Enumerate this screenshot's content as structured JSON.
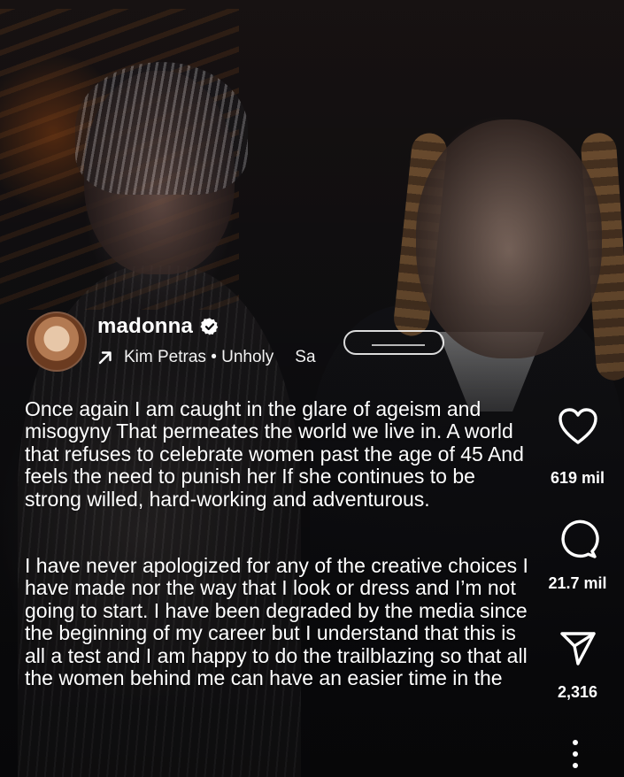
{
  "post": {
    "username": "madonna",
    "audio": "Kim Petras • Unholy",
    "audio_overflow": "Sa",
    "caption_para1": "Once again I am caught in the glare of ageism and misogyny  That permeates  the world we live in. A world that refuses to celebrate women past the age of 45 And feels the need to punish her If she continues to be strong willed,  hard-working  and adventurous.",
    "caption_para2": "I have never apologized for any of the creative choices I have made nor the way that I look or dress and I’m not going to start. I have been degraded by the media since the beginning of my career but I understand that this is all a test and I am happy to do the trailblazing  so that all the women behind me can have an easier time in the"
  },
  "actions": {
    "likes": "619 mil",
    "comments": "21.7 mil",
    "shares": "2,316"
  },
  "icons": {
    "verified": "verified-badge-icon",
    "audio": "arrow-icon",
    "like": "heart-icon",
    "comment": "comment-icon",
    "share": "send-icon",
    "more": "more-vertical-icon"
  },
  "colors": {
    "text": "#ffffff",
    "background": "#0b0b0d"
  }
}
